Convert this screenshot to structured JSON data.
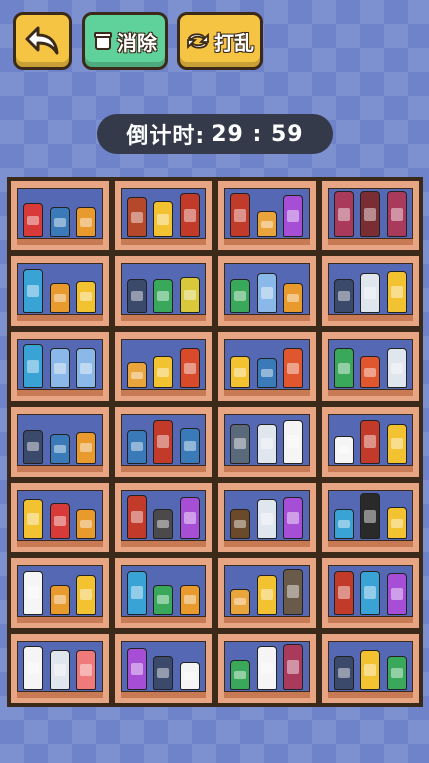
{
  "toolbar": {
    "back_icon": "back-arrow-icon",
    "clear_label": "消除",
    "clear_icon": "trash-icon",
    "shuffle_label": "打乱",
    "shuffle_icon": "shuffle-icon"
  },
  "timer": {
    "label": "倒计时:",
    "value": "29 : 59"
  },
  "board": {
    "cells": [
      [
        {
          "name": "cola-bottle",
          "color": "#d83a3a",
          "h": 34
        },
        {
          "name": "coffee-can",
          "color": "#3a7ab8",
          "h": 30
        },
        {
          "name": "honey-jar",
          "color": "#e89a2c",
          "h": 30
        }
      ],
      [
        {
          "name": "ketchup-bottle",
          "color": "#b5472a",
          "h": 40
        },
        {
          "name": "lotion-bottle",
          "color": "#f2c230",
          "h": 36
        },
        {
          "name": "chips-tube",
          "color": "#c23a2a",
          "h": 44
        }
      ],
      [
        {
          "name": "chips-tube",
          "color": "#c23a2a",
          "h": 44
        },
        {
          "name": "candle-jar",
          "color": "#e9a43c",
          "h": 26
        },
        {
          "name": "spray-bottle",
          "color": "#a64fd6",
          "h": 42
        }
      ],
      [
        {
          "name": "wine-bottle",
          "color": "#a93a5b",
          "h": 46
        },
        {
          "name": "wine-bottle",
          "color": "#7a2e33",
          "h": 46
        },
        {
          "name": "wine-bottle",
          "color": "#a93a5b",
          "h": 46
        }
      ],
      [
        {
          "name": "chips-tube",
          "color": "#3aa3d6",
          "h": 44
        },
        {
          "name": "honey-jar",
          "color": "#e89a2c",
          "h": 30
        },
        {
          "name": "juice-box",
          "color": "#f2c230",
          "h": 32
        }
      ],
      [
        {
          "name": "owl-figure",
          "color": "#3b4a6b",
          "h": 34
        },
        {
          "name": "tea-box",
          "color": "#3aa85a",
          "h": 34
        },
        {
          "name": "honey-jar",
          "color": "#d8c83a",
          "h": 36
        }
      ],
      [
        {
          "name": "tea-box",
          "color": "#3aa85a",
          "h": 34
        },
        {
          "name": "shampoo-bottle",
          "color": "#8ab8e8",
          "h": 40
        },
        {
          "name": "honey-jar",
          "color": "#e89a2c",
          "h": 30
        }
      ],
      [
        {
          "name": "owl-figure",
          "color": "#3b4a6b",
          "h": 34
        },
        {
          "name": "soap-dispenser",
          "color": "#dfe6ee",
          "h": 40
        },
        {
          "name": "lotion-bottle",
          "color": "#f2c230",
          "h": 42
        }
      ],
      [
        {
          "name": "chips-tube",
          "color": "#3aa3d6",
          "h": 44
        },
        {
          "name": "shampoo-bottle",
          "color": "#8ab8e8",
          "h": 40
        },
        {
          "name": "shampoo-bottle",
          "color": "#8ab8e8",
          "h": 40
        }
      ],
      [
        {
          "name": "candle-jar",
          "color": "#e9a43c",
          "h": 26
        },
        {
          "name": "juice-box",
          "color": "#f2c230",
          "h": 32
        },
        {
          "name": "ketchup-bottle",
          "color": "#d84a2a",
          "h": 40
        }
      ],
      [
        {
          "name": "juice-box",
          "color": "#f2c230",
          "h": 32
        },
        {
          "name": "snack-bag",
          "color": "#3a7ab8",
          "h": 30
        },
        {
          "name": "fries-box",
          "color": "#e0572f",
          "h": 40
        }
      ],
      [
        {
          "name": "spray-bottle",
          "color": "#3aa85a",
          "h": 40
        },
        {
          "name": "fries-box",
          "color": "#e0572f",
          "h": 32
        },
        {
          "name": "soap-dispenser",
          "color": "#dfe6ee",
          "h": 40
        }
      ],
      [
        {
          "name": "owl-figure",
          "color": "#3b4a6b",
          "h": 34
        },
        {
          "name": "snack-bag",
          "color": "#3a7ab8",
          "h": 30
        },
        {
          "name": "honey-jar",
          "color": "#e89a2c",
          "h": 32
        }
      ],
      [
        {
          "name": "tea-box",
          "color": "#3a7ab8",
          "h": 34
        },
        {
          "name": "chips-tube",
          "color": "#c23a2a",
          "h": 44
        },
        {
          "name": "coffee-can",
          "color": "#3a7ab8",
          "h": 36
        }
      ],
      [
        {
          "name": "coffee-maker",
          "color": "#5a6a7a",
          "h": 40
        },
        {
          "name": "soap-dispenser",
          "color": "#dfe6ee",
          "h": 40
        },
        {
          "name": "milk-bottle",
          "color": "#f5f5f5",
          "h": 44
        }
      ],
      [
        {
          "name": "toilet-paper",
          "color": "#f5f5f5",
          "h": 28
        },
        {
          "name": "chips-tube",
          "color": "#c23a2a",
          "h": 44
        },
        {
          "name": "lotion-bottle",
          "color": "#f2c230",
          "h": 40
        }
      ],
      [
        {
          "name": "lotion-bottle",
          "color": "#f2c230",
          "h": 40
        },
        {
          "name": "cola-bottle",
          "color": "#d83a3a",
          "h": 36
        },
        {
          "name": "honey-jar",
          "color": "#e89a2c",
          "h": 30
        }
      ],
      [
        {
          "name": "chips-tube",
          "color": "#c23a2a",
          "h": 44
        },
        {
          "name": "coffee-maker",
          "color": "#4a4a4a",
          "h": 30
        },
        {
          "name": "spray-bottle",
          "color": "#a64fd6",
          "h": 42
        }
      ],
      [
        {
          "name": "coffee-maker",
          "color": "#6a4a2a",
          "h": 30
        },
        {
          "name": "soap-dispenser",
          "color": "#dfe6ee",
          "h": 40
        },
        {
          "name": "spray-bottle",
          "color": "#a64fd6",
          "h": 42
        }
      ],
      [
        {
          "name": "tv-box",
          "color": "#3aa3d6",
          "h": 30
        },
        {
          "name": "microphone",
          "color": "#2a2a2a",
          "h": 46
        },
        {
          "name": "juice-box",
          "color": "#f2c230",
          "h": 32
        }
      ],
      [
        {
          "name": "milk-bottle",
          "color": "#f5f5f5",
          "h": 44
        },
        {
          "name": "honey-jar",
          "color": "#e89a2c",
          "h": 30
        },
        {
          "name": "lotion-bottle",
          "color": "#f2c230",
          "h": 40
        }
      ],
      [
        {
          "name": "chips-tube",
          "color": "#3aa3d6",
          "h": 44
        },
        {
          "name": "tea-box",
          "color": "#3aa85a",
          "h": 30
        },
        {
          "name": "honey-jar",
          "color": "#e89a2c",
          "h": 30
        }
      ],
      [
        {
          "name": "candle-jar",
          "color": "#e9a43c",
          "h": 26
        },
        {
          "name": "lotion-bottle",
          "color": "#f2c230",
          "h": 40
        },
        {
          "name": "hair-dryer",
          "color": "#6a5a4a",
          "h": 46
        }
      ],
      [
        {
          "name": "chips-tube",
          "color": "#c23a2a",
          "h": 44
        },
        {
          "name": "chips-tube",
          "color": "#3aa3d6",
          "h": 44
        },
        {
          "name": "spray-bottle",
          "color": "#a64fd6",
          "h": 42
        }
      ],
      [
        {
          "name": "milk-bottle",
          "color": "#f5f5f5",
          "h": 44
        },
        {
          "name": "soap-dispenser",
          "color": "#dfe6ee",
          "h": 40
        },
        {
          "name": "cream-tube",
          "color": "#f07a7a",
          "h": 40
        }
      ],
      [
        {
          "name": "spray-bottle",
          "color": "#a64fd6",
          "h": 42
        },
        {
          "name": "owl-figure",
          "color": "#3b4a6b",
          "h": 34
        },
        {
          "name": "toilet-paper",
          "color": "#f5f5f5",
          "h": 28
        }
      ],
      [
        {
          "name": "tea-box",
          "color": "#3aa85a",
          "h": 30
        },
        {
          "name": "milk-bottle",
          "color": "#f5f5f5",
          "h": 44
        },
        {
          "name": "wine-bottle",
          "color": "#a93a5b",
          "h": 46
        }
      ],
      [
        {
          "name": "owl-figure",
          "color": "#3b4a6b",
          "h": 34
        },
        {
          "name": "lotion-bottle",
          "color": "#f2c230",
          "h": 40
        },
        {
          "name": "tea-box",
          "color": "#3aa85a",
          "h": 34
        }
      ]
    ]
  }
}
